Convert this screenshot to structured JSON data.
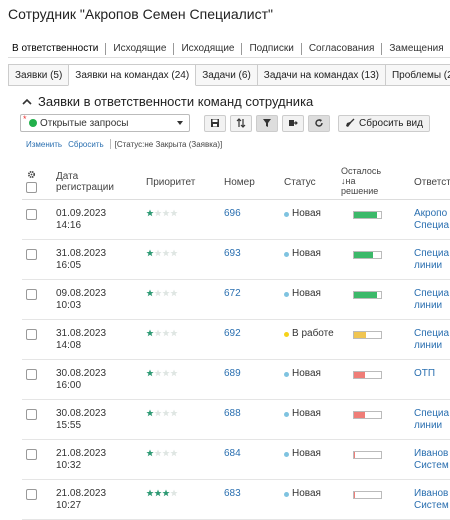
{
  "page": {
    "title": "Сотрудник \"Акропов Семен Специалист\""
  },
  "tabs_main": [
    {
      "label": "В ответственности",
      "active": true
    },
    {
      "label": "Исходящие",
      "active": false
    },
    {
      "label": "Исходящие",
      "active": false
    },
    {
      "label": "Подписки",
      "active": false
    },
    {
      "label": "Согласования",
      "active": false
    },
    {
      "label": "Замещения",
      "active": false
    }
  ],
  "tabs_sub": [
    {
      "label": "Заявки (5)",
      "active": false
    },
    {
      "label": "Заявки на командах (24)",
      "active": true
    },
    {
      "label": "Задачи (6)",
      "active": false
    },
    {
      "label": "Задачи на командах (13)",
      "active": false
    },
    {
      "label": "Проблемы (2)",
      "active": false
    }
  ],
  "section": {
    "title": "Заявки в ответственности команд сотрудника"
  },
  "toolbar": {
    "filter_required_mark": "*",
    "filter_value": "Открытые запросы",
    "reset_label": "Сбросить вид"
  },
  "filter_bar": {
    "edit_label": "Изменить",
    "reset_label": "Сбросить",
    "status_prefix": "[Статус: ",
    "status_value": "не Закрыта (Заявка)",
    "status_suffix": "]"
  },
  "columns": {
    "date_line1": "Дата",
    "date_line2": "регистрации",
    "priority": "Приоритет",
    "number": "Номер",
    "status": "Статус",
    "remaining_line1": "Осталось",
    "remaining_line2": "на",
    "remaining_line3": "решение",
    "responsible": "Ответст"
  },
  "colors": {
    "green": "#3cb96a",
    "yellow": "#f0c552",
    "red": "#ef7d77",
    "status_new": "#7ec3e0",
    "status_in_work": "#f5d21a"
  },
  "rows": [
    {
      "date": "01.09.2023",
      "time": "14:16",
      "stars": 1,
      "number": "696",
      "status": "Новая",
      "status_color": "#7ec3e0",
      "remaining": 0.85,
      "bar_color": "#3cb96a",
      "resp1": "Акропо",
      "resp2": "Специа"
    },
    {
      "date": "31.08.2023",
      "time": "16:05",
      "stars": 1,
      "number": "693",
      "status": "Новая",
      "status_color": "#7ec3e0",
      "remaining": 0.7,
      "bar_color": "#3cb96a",
      "resp1": "Специа",
      "resp2": "линии"
    },
    {
      "date": "09.08.2023",
      "time": "10:03",
      "stars": 1,
      "number": "672",
      "status": "Новая",
      "status_color": "#7ec3e0",
      "remaining": 0.85,
      "bar_color": "#3cb96a",
      "resp1": "Специа",
      "resp2": "линии"
    },
    {
      "date": "31.08.2023",
      "time": "14:08",
      "stars": 1,
      "number": "692",
      "status": "В работе",
      "status_color": "#f5d21a",
      "remaining": 0.45,
      "bar_color": "#f0c552",
      "resp1": "Специа",
      "resp2": "линии"
    },
    {
      "date": "30.08.2023",
      "time": "16:00",
      "stars": 1,
      "number": "689",
      "status": "Новая",
      "status_color": "#7ec3e0",
      "remaining": 0.4,
      "bar_color": "#ef7d77",
      "resp1": "ОТП",
      "resp2": ""
    },
    {
      "date": "30.08.2023",
      "time": "15:55",
      "stars": 1,
      "number": "688",
      "status": "Новая",
      "status_color": "#7ec3e0",
      "remaining": 0.4,
      "bar_color": "#ef7d77",
      "resp1": "Специа",
      "resp2": "линии"
    },
    {
      "date": "21.08.2023",
      "time": "10:32",
      "stars": 1,
      "number": "684",
      "status": "Новая",
      "status_color": "#7ec3e0",
      "remaining": 0.05,
      "bar_color": "#ef7d77",
      "resp1": "Иванов",
      "resp2": "Систем"
    },
    {
      "date": "21.08.2023",
      "time": "10:27",
      "stars": 3,
      "number": "683",
      "status": "Новая",
      "status_color": "#7ec3e0",
      "remaining": 0.05,
      "bar_color": "#ef7d77",
      "resp1": "Иванов",
      "resp2": "Систем"
    }
  ]
}
